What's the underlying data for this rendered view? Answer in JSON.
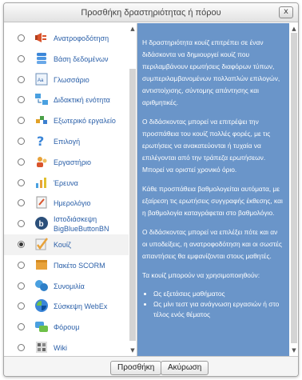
{
  "dialog": {
    "title": "Προσθήκη δραστηριότητας ή πόρου",
    "close_label": "x"
  },
  "modules": [
    {
      "label": "Ανατροφοδότηση",
      "icon": "feedback-icon",
      "selected": false
    },
    {
      "label": "Βάση δεδομένων",
      "icon": "database-icon",
      "selected": false
    },
    {
      "label": "Γλωσσάριο",
      "icon": "glossary-icon",
      "selected": false
    },
    {
      "label": "Διδακτική ενότητα",
      "icon": "lesson-icon",
      "selected": false
    },
    {
      "label": "Εξωτερικό εργαλείο",
      "icon": "external-tool-icon",
      "selected": false
    },
    {
      "label": "Επιλογή",
      "icon": "choice-icon",
      "selected": false
    },
    {
      "label": "Εργαστήριο",
      "icon": "workshop-icon",
      "selected": false
    },
    {
      "label": "Έρευνα",
      "icon": "survey-icon",
      "selected": false
    },
    {
      "label": "Ημερολόγιο",
      "icon": "journal-icon",
      "selected": false
    },
    {
      "label": "Ιστοδιάσκεψη BigBlueButtonBN",
      "icon": "bigbluebutton-icon",
      "selected": false
    },
    {
      "label": "Κουίζ",
      "icon": "quiz-icon",
      "selected": true
    },
    {
      "label": "Πακέτο SCORM",
      "icon": "scorm-icon",
      "selected": false
    },
    {
      "label": "Συνομιλία",
      "icon": "chat-icon",
      "selected": false
    },
    {
      "label": "Σύσκεψη WebEx",
      "icon": "webex-icon",
      "selected": false
    },
    {
      "label": "Φόρουμ",
      "icon": "forum-icon",
      "selected": false
    },
    {
      "label": "Wiki",
      "icon": "wiki-icon",
      "selected": false
    }
  ],
  "description": {
    "paragraphs": [
      "Η δραστηριότητα κουίζ επιτρέπει σε έναν διδάσκοντα να δημιουργεί κουίζ που περιλαμβάνουν ερωτήσεις διαφόρων τύπων, συμπεριλαμβανομένων πολλαπλών επιλογών, αντιστοίχισης, σύντομης απάντησης και αριθμητικές.",
      "Ο διδάσκοντας μπορεί να επιτρέψει την προσπάθεια του κουίζ πολλές φορές, με τις ερωτήσεις να ανακατεύονται ή τυχαία να επιλέγονται από την τράπεζα ερωτήσεων. Μπορεί να οριστεί χρονικό όριο.",
      "Κάθε προσπάθεια βαθμολογείται αυτόματα, με εξαίρεση τις ερωτήσεις συγγραφής έκθεσης, και η βαθμολογία καταγράφεται στο βαθμολόγιο.",
      "Ο διδάσκοντας μπορεί να επιλέξει πότε και αν οι υποδείξεις, η ανατροφοδότηση και οι σωστές απαντήσεις θα εμφανίζονται στους μαθητές.",
      "Τα κουίζ μπορούν να χρησιμοποιηθούν:"
    ],
    "bullets": [
      "Ως εξετάσεις μαθήματος",
      "Ως μίνι τεστ για ανάγνωση εργασιών ή στο τέλος ενός θέματος"
    ]
  },
  "footer": {
    "add_label": "Προσθήκη",
    "cancel_label": "Ακύρωση"
  },
  "colors": {
    "description_bg": "#6a95c9",
    "link_text": "#2a5fa8"
  }
}
